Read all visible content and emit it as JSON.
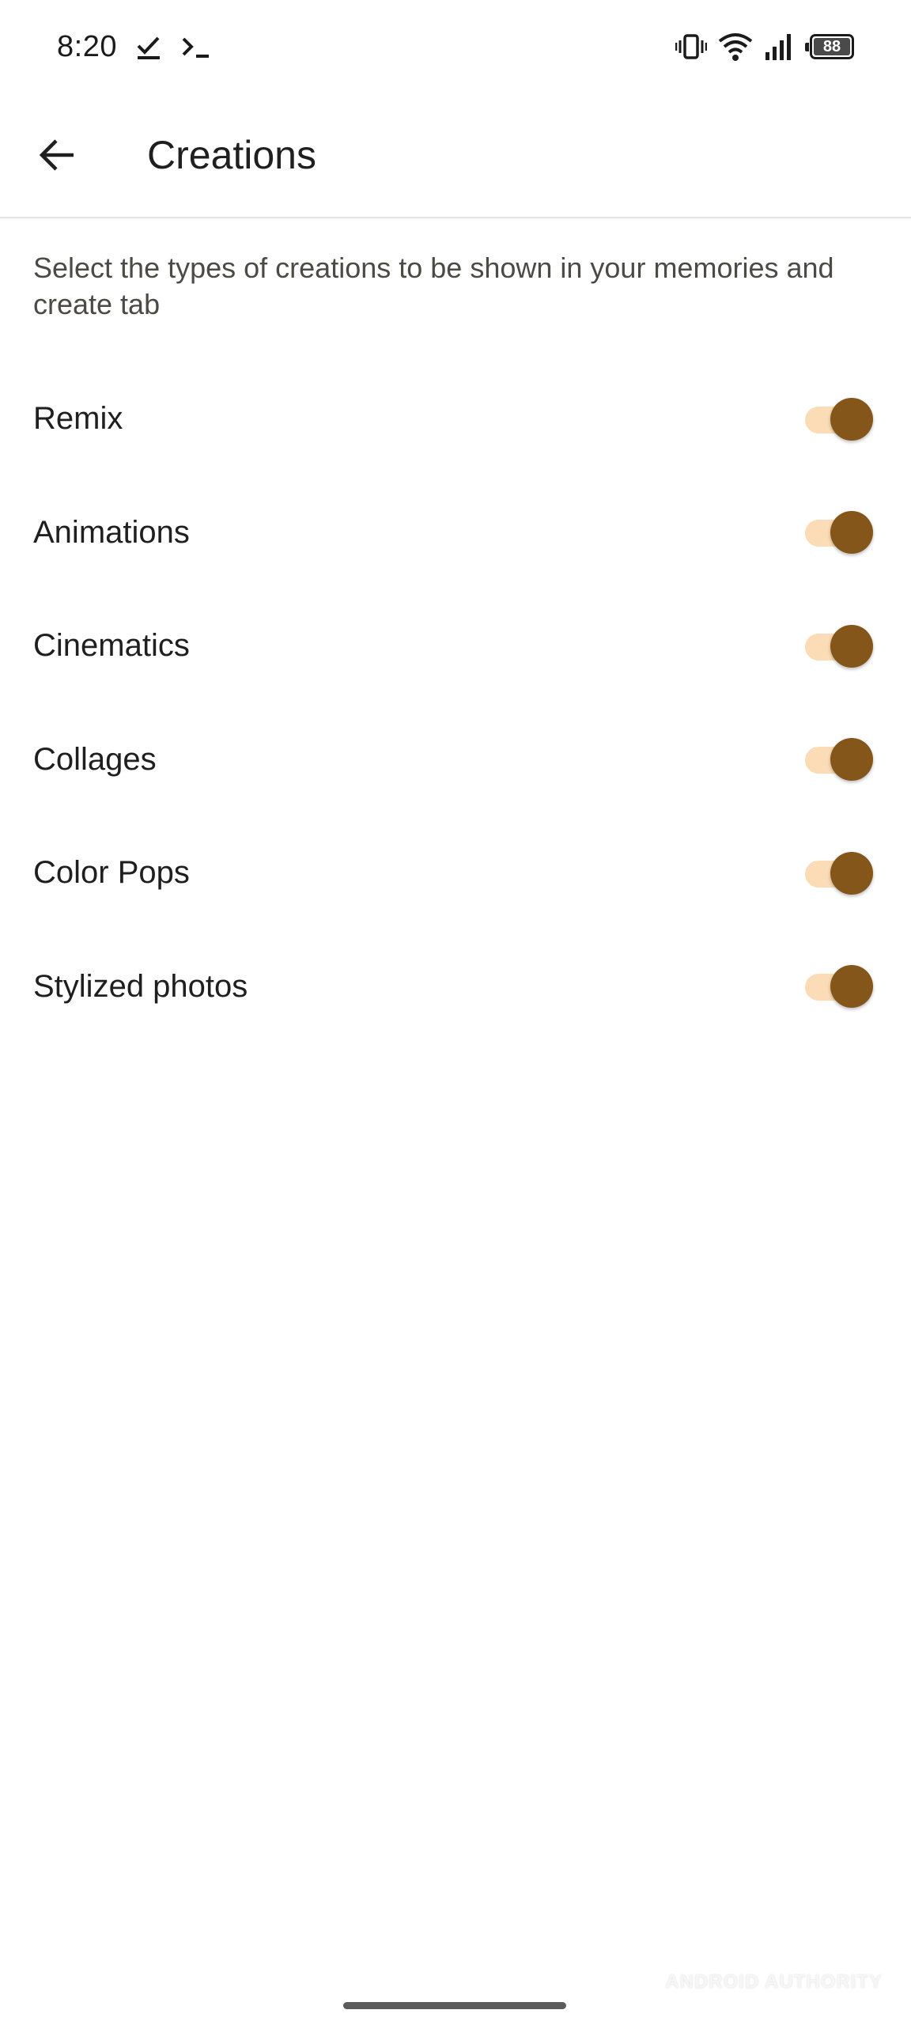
{
  "status_bar": {
    "time": "8:20",
    "left_icons": [
      "check-icon",
      "terminal-icon"
    ],
    "right_icons": [
      "vibrate-icon",
      "wifi-icon",
      "signal-icon",
      "battery-icon"
    ],
    "battery_level": "88"
  },
  "app_bar": {
    "back_icon": "arrow-back-icon",
    "title": "Creations"
  },
  "description": "Select the types of creations to be shown in your memories and create tab",
  "settings": [
    {
      "label": "Remix",
      "enabled": true
    },
    {
      "label": "Animations",
      "enabled": true
    },
    {
      "label": "Cinematics",
      "enabled": true
    },
    {
      "label": "Collages",
      "enabled": true
    },
    {
      "label": "Color Pops",
      "enabled": true
    },
    {
      "label": "Stylized photos",
      "enabled": true
    }
  ],
  "colors": {
    "switch_thumb": "#84561a",
    "switch_track": "#fcdcb7",
    "text_primary": "#1f1f1f",
    "text_secondary": "#4d4a46"
  },
  "watermark": "ANDROID AUTHORITY"
}
